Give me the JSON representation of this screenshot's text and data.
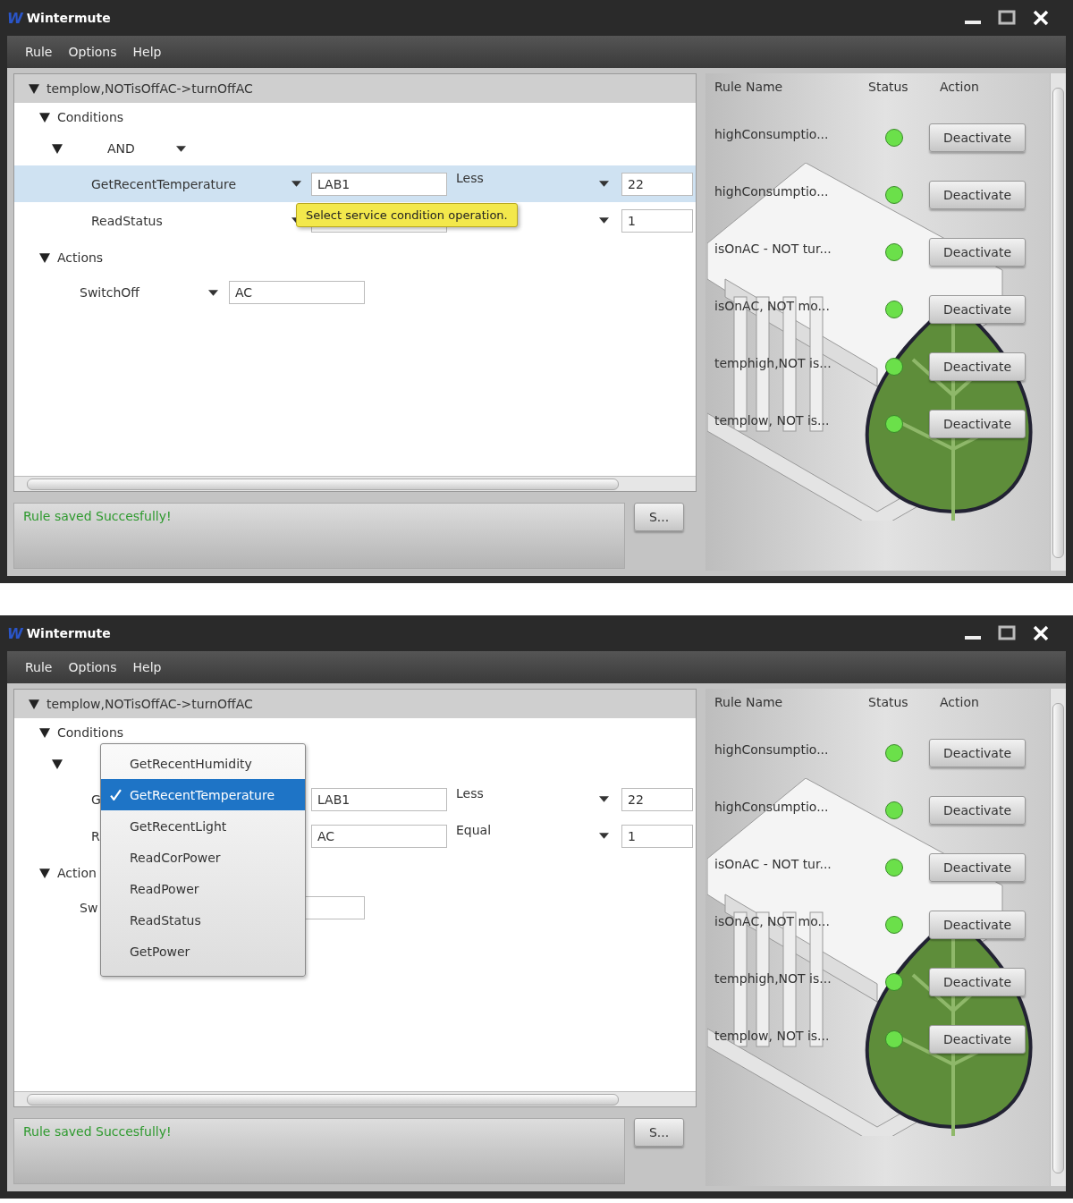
{
  "windows": [
    {
      "logo": "W",
      "title": "Wintermute",
      "menu": [
        "Rule",
        "Options",
        "Help"
      ],
      "rule_title": "templow,NOTisOffAC->turnOffAC",
      "conditions_label": "Conditions",
      "operator": "AND",
      "conditions": [
        {
          "service": "GetRecentTemperature",
          "target": "LAB1",
          "comparison": "Less",
          "value": "22",
          "selected": true
        },
        {
          "service": "ReadStatus",
          "value": "1",
          "selected": false
        }
      ],
      "actions_label": "Actions",
      "actions": [
        {
          "service": "SwitchOff",
          "target": "AC"
        }
      ],
      "tooltip": "Select service condition operation.",
      "status_message": "Rule saved Succesfully!",
      "save_button": "S...",
      "rules_columns": [
        "Rule Name",
        "Status",
        "Action"
      ],
      "rules": [
        {
          "name": "highConsumptio...",
          "active": true,
          "action": "Deactivate"
        },
        {
          "name": "highConsumptio...",
          "active": true,
          "action": "Deactivate"
        },
        {
          "name": "isOnAC - NOT tur...",
          "active": true,
          "action": "Deactivate"
        },
        {
          "name": "isOnAC, NOT mo...",
          "active": true,
          "action": "Deactivate"
        },
        {
          "name": "temphigh,NOT is...",
          "active": true,
          "action": "Deactivate"
        },
        {
          "name": "templow, NOT is...",
          "active": true,
          "action": "Deactivate"
        }
      ]
    },
    {
      "logo": "W",
      "title": "Wintermute",
      "menu": [
        "Rule",
        "Options",
        "Help"
      ],
      "rule_title": "templow,NOTisOffAC->turnOffAC",
      "conditions_label": "Conditions",
      "conditions": [
        {
          "service": "G",
          "target": "LAB1",
          "comparison": "Less",
          "value": "22"
        },
        {
          "service": "R",
          "target": "AC",
          "comparison": "Equal",
          "value": "1"
        }
      ],
      "actions_label": "Action",
      "actions": [
        {
          "service": "Sw"
        }
      ],
      "dropdown": [
        {
          "label": "GetRecentHumidity",
          "selected": false
        },
        {
          "label": "GetRecentTemperature",
          "selected": true
        },
        {
          "label": "GetRecentLight",
          "selected": false
        },
        {
          "label": "ReadCorPower",
          "selected": false
        },
        {
          "label": "ReadPower",
          "selected": false
        },
        {
          "label": "ReadStatus",
          "selected": false
        },
        {
          "label": "GetPower",
          "selected": false
        }
      ],
      "status_message": "Rule saved Succesfully!",
      "save_button": "S...",
      "rules_columns": [
        "Rule Name",
        "Status",
        "Action"
      ],
      "rules": [
        {
          "name": "highConsumptio...",
          "active": true,
          "action": "Deactivate"
        },
        {
          "name": "highConsumptio...",
          "active": true,
          "action": "Deactivate"
        },
        {
          "name": "isOnAC - NOT tur...",
          "active": true,
          "action": "Deactivate"
        },
        {
          "name": "isOnAC, NOT mo...",
          "active": true,
          "action": "Deactivate"
        },
        {
          "name": "temphigh,NOT is...",
          "active": true,
          "action": "Deactivate"
        },
        {
          "name": "templow, NOT is...",
          "active": true,
          "action": "Deactivate"
        }
      ]
    }
  ]
}
